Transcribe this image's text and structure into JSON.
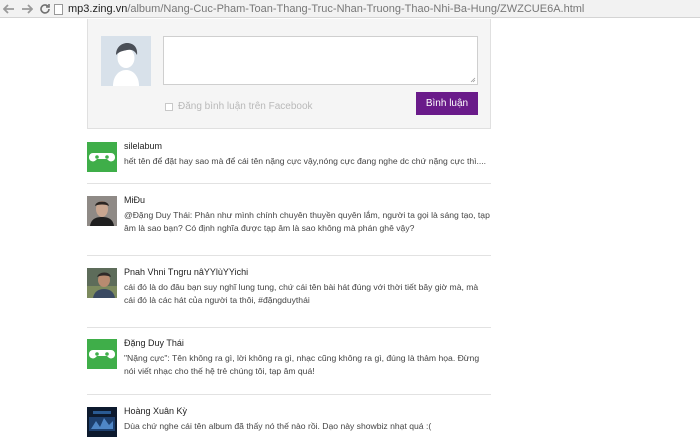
{
  "browser": {
    "url_host": "mp3.zing.vn",
    "url_path": "/album/Nang-Cuc-Pham-Toan-Thang-Truc-Nhan-Truong-Thao-Nhi-Ba-Hung/ZWZCUE6A.html"
  },
  "comment_form": {
    "textarea_value": "",
    "facebook_checkbox_label": "Đăng bình luận trên Facebook",
    "submit_label": "Bình luận",
    "accent_color": "#6a1b8a"
  },
  "comments": [
    {
      "author": "silelabum",
      "text": "hết tên để đặt hay sao mà để cái tên nặng cực vậy,nóng cực đang nghe dc chứ nặng cực thì....",
      "avatar": "gamepad-icon"
    },
    {
      "author": "MiĐu",
      "text": "@Đặng Duy Thái: Phản như mình chính chuyên thuyền quyên lắm, người ta gọi là sáng tạo, tạp âm là sao bạn? Có định nghĩa được tạp âm là sao không mà phán ghê vậy?",
      "avatar": "photo"
    },
    {
      "author": "Pnah Vhni Tngru nâYYlùYYichi",
      "text": "cái đó là do đâu bạn suy nghĩ lung tung, chứ cái tên bài hát đúng với thời tiết bây giờ mà, mà cái đó là các hát của người ta thôi, #đặngduythái",
      "avatar": "photo"
    },
    {
      "author": "Đặng Duy Thái",
      "text": "\"Nặng cực\": Tên không ra gì, lời không ra gì, nhạc cũng không ra gì, đúng là thảm họa. Đừng nói viết nhạc cho thế hệ trẻ chúng tôi, tạp âm quá!",
      "avatar": "gamepad-icon"
    },
    {
      "author": "Hoàng Xuân Kỳ",
      "text": "Dùa chứ nghe cái tên album đã thấy nó thế nào rồi. Dạo này showbiz nhạt quá :(",
      "avatar": "photo"
    }
  ]
}
